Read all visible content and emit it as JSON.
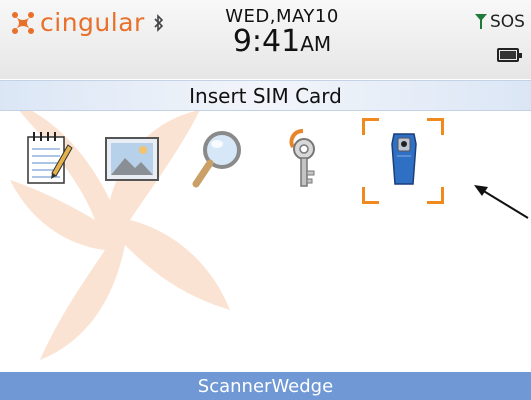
{
  "status_bar": {
    "carrier": "cingular",
    "date": "WED,MAY10",
    "time": "9:41",
    "ampm": "AM",
    "signal_text": "SOS",
    "icons": [
      "cingular-logo-icon",
      "bluetooth-icon",
      "signal-antenna-icon",
      "battery-icon"
    ]
  },
  "banner": {
    "text": "Insert SIM Card"
  },
  "apps": [
    {
      "icon": "notepad-icon"
    },
    {
      "icon": "picture-icon"
    },
    {
      "icon": "magnifier-icon"
    },
    {
      "icon": "key-icon"
    },
    {
      "icon": "scanner-icon",
      "selected": true
    }
  ],
  "selected_app": {
    "label": "ScannerWedge"
  },
  "colors": {
    "carrier_orange": "#e8702a",
    "focus_orange": "#f08a1e",
    "title_bar_blue": "#6f98d4",
    "banner_blue": "#dbe6f5"
  }
}
